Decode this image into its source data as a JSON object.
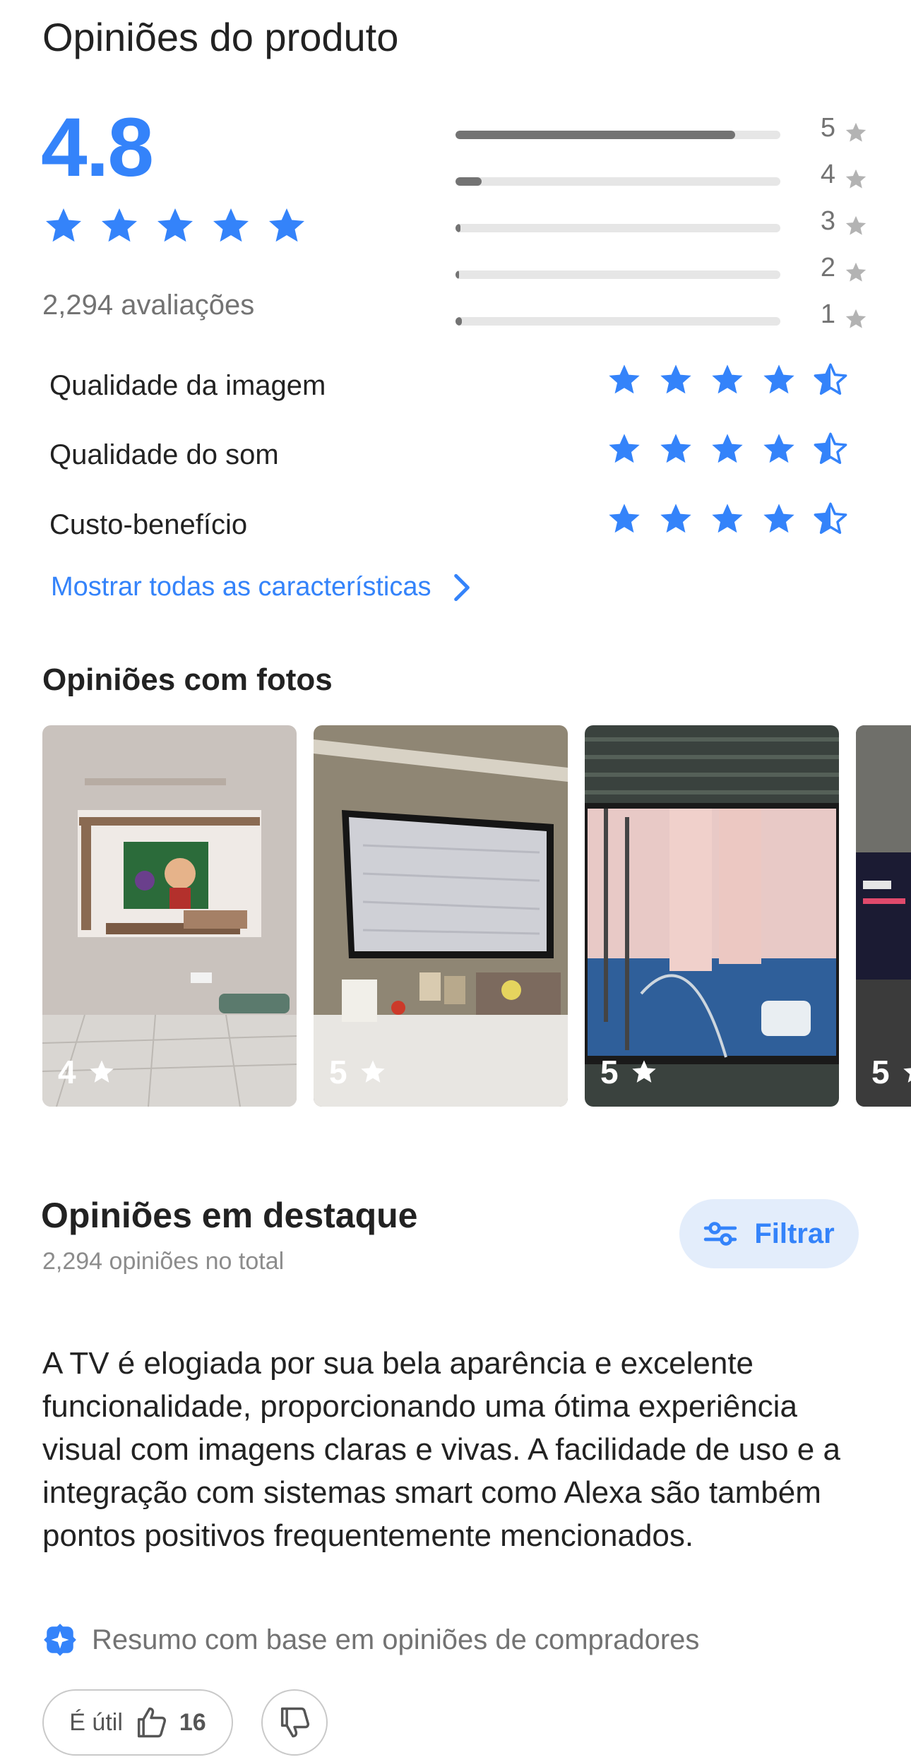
{
  "header": {
    "title": "Opiniões do produto"
  },
  "summary_block": {
    "average": "4.8",
    "average_stars": 5,
    "total_reviews": "2,294 avaliações"
  },
  "distribution": [
    {
      "stars": "5",
      "fraction": 0.86
    },
    {
      "stars": "4",
      "fraction": 0.08
    },
    {
      "stars": "3",
      "fraction": 0.015
    },
    {
      "stars": "2",
      "fraction": 0.005
    },
    {
      "stars": "1",
      "fraction": 0.02
    }
  ],
  "features": [
    {
      "label": "Qualidade da imagem",
      "rating": 4.5
    },
    {
      "label": "Qualidade do som",
      "rating": 4.5
    },
    {
      "label": "Custo-benefício",
      "rating": 4.5
    }
  ],
  "show_all_label": "Mostrar todas as características",
  "photos_section": {
    "title": "Opiniões com fotos",
    "photos": [
      {
        "rating": "4"
      },
      {
        "rating": "5"
      },
      {
        "rating": "5"
      },
      {
        "rating": "5"
      }
    ]
  },
  "featured": {
    "title": "Opiniões em destaque",
    "subtitle": "2,294 opiniões no total",
    "filter_label": "Filtrar",
    "summary_text": "A TV é elogiada por sua bela aparência e excelente funcionalidade, proporcionando uma ótima experiência visual com imagens claras e vivas. A facilidade de uso e a integração com sistemas smart como Alexa são também pontos positivos frequentemente mencionados.",
    "summary_note": "Resumo com base em opiniões de compradores",
    "useful_label": "É útil",
    "useful_count": "16"
  },
  "colors": {
    "accent": "#3483fa",
    "bar": "#737373",
    "track": "#e6e6e6",
    "grey_star": "#b3b3b3"
  },
  "icons": [
    "star-icon",
    "half-star-icon",
    "chevron-right-icon",
    "filter-icon",
    "sparkle-icon",
    "thumbs-up-icon",
    "thumbs-down-icon"
  ]
}
